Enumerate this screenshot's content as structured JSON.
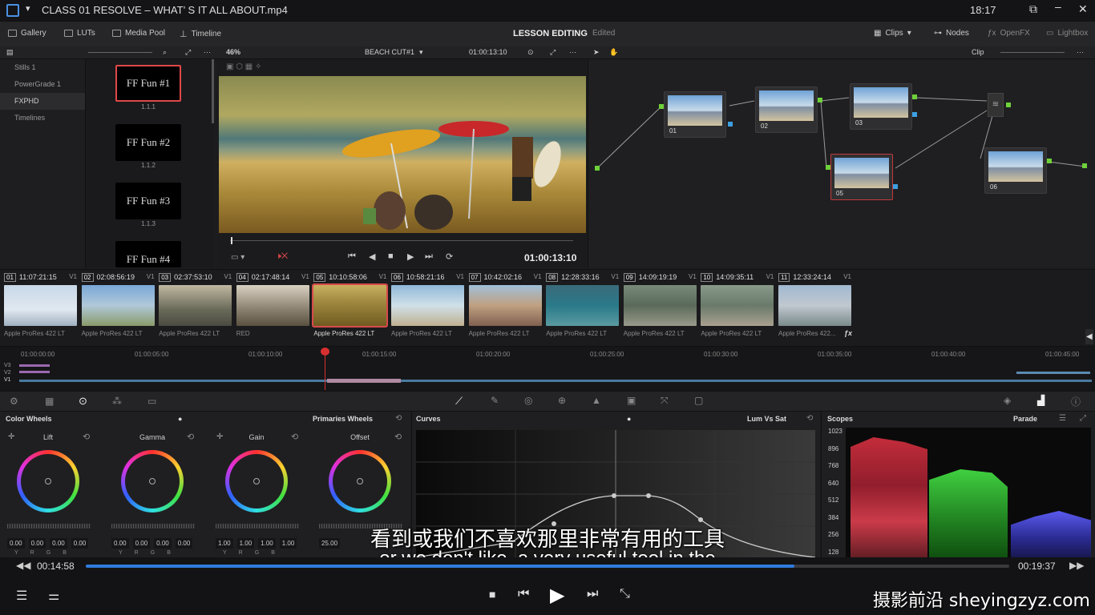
{
  "player": {
    "title": "CLASS 01 RESOLVE – WHAT’ S IT ALL ABOUT.mp4",
    "clock": "18:17",
    "current": "00:14:58",
    "total": "00:19:37",
    "progress": 0.767
  },
  "toolbar": {
    "gallery": "Gallery",
    "luts": "LUTs",
    "media_pool": "Media Pool",
    "timeline": "Timeline",
    "project": "LESSON EDITING",
    "status": "Edited",
    "clips": "Clips",
    "nodes": "Nodes",
    "openfx": "OpenFX",
    "lightbox": "Lightbox"
  },
  "subbar": {
    "zoom": "46%",
    "timeline_name": "BEACH CUT#1",
    "timecode": "01:00:13:10",
    "clip_mode": "Clip"
  },
  "gallery": {
    "items": [
      "Stills 1",
      "PowerGrade 1",
      "FXPHD",
      "Timelines"
    ],
    "selected": 2
  },
  "stills": [
    {
      "name": "FF Fun #1",
      "label": "1.1.1"
    },
    {
      "name": "FF Fun #2",
      "label": "1.1.2"
    },
    {
      "name": "FF Fun #3",
      "label": "1.1.3"
    },
    {
      "name": "FF Fun #4",
      "label": ""
    }
  ],
  "viewer": {
    "timecode": "01:00:13:10"
  },
  "nodes": [
    {
      "label": "01"
    },
    {
      "label": "02"
    },
    {
      "label": "03"
    },
    {
      "label": "05"
    },
    {
      "label": "06"
    }
  ],
  "clips": [
    {
      "num": "01",
      "tc": "11:07:21:15",
      "track": "V1",
      "codec": "Apple ProRes 422 LT",
      "bg": "linear-gradient(#c8d8e8,#e0e8f0 60%,#a0b0c0)"
    },
    {
      "num": "02",
      "tc": "02:08:56:19",
      "track": "V1",
      "codec": "Apple ProRes 422 LT",
      "bg": "linear-gradient(#7aa8d8,#b0c8d8 50%,#8a9a6a)"
    },
    {
      "num": "03",
      "tc": "02:37:53:10",
      "track": "V1",
      "codec": "Apple ProRes 422 LT",
      "bg": "linear-gradient(#c0b8a0,#6a6a5a 60%,#4a4a40)"
    },
    {
      "num": "04",
      "tc": "02:17:48:14",
      "track": "V1",
      "codec": "RED",
      "bg": "linear-gradient(#d8d0c0,#8a8070 60%,#5a5040)"
    },
    {
      "num": "05",
      "tc": "10:10:58:06",
      "track": "V1",
      "codec": "Apple ProRes 422 LT",
      "bg": "linear-gradient(#c8b060,#a08a40 40%,#705a20)"
    },
    {
      "num": "06",
      "tc": "10:58:21:16",
      "track": "V1",
      "codec": "Apple ProRes 422 LT",
      "bg": "linear-gradient(#90b8d8,#d0e0e8 50%,#c0b090)"
    },
    {
      "num": "07",
      "tc": "10:42:02:16",
      "track": "V1",
      "codec": "Apple ProRes 422 LT",
      "bg": "linear-gradient(#a0c0d8,#c0a080 50%,#806050)"
    },
    {
      "num": "08",
      "tc": "12:28:33:16",
      "track": "V1",
      "codec": "Apple ProRes 422 LT",
      "bg": "linear-gradient(#3a6a7a,#2a7a8a 50%,#5a9aa0)"
    },
    {
      "num": "09",
      "tc": "14:09:19:19",
      "track": "V1",
      "codec": "Apple ProRes 422 LT",
      "bg": "linear-gradient(#7a8a7a,#5a6a5a 50%,#9a9a8a)"
    },
    {
      "num": "10",
      "tc": "14:09:35:11",
      "track": "V1",
      "codec": "Apple ProRes 422 LT",
      "bg": "linear-gradient(#8a9a8a,#6a7a6a 50%,#aaa090)"
    },
    {
      "num": "11",
      "tc": "12:33:24:14",
      "track": "V1",
      "codec": "Apple ProRes 422...",
      "bg": "linear-gradient(#a0b8d0,#c0c8d0 50%,#7a8a8a)"
    }
  ],
  "timeline": {
    "ticks": [
      "01:00:00:00",
      "01:00:05:00",
      "01:00:10:00",
      "01:00:15:00",
      "01:00:20:00",
      "01:00:25:00",
      "01:00:30:00",
      "01:00:35:00",
      "01:00:40:00",
      "01:00:45:00"
    ],
    "tracks": [
      "V3",
      "V2",
      "V1"
    ]
  },
  "wheels": {
    "title": "Color Wheels",
    "mode": "Primaries Wheels",
    "items": [
      {
        "name": "Lift",
        "vals": [
          "0.00",
          "0.00",
          "0.00",
          "0.00"
        ]
      },
      {
        "name": "Gamma",
        "vals": [
          "0.00",
          "0.00",
          "0.00",
          "0.00"
        ]
      },
      {
        "name": "Gain",
        "vals": [
          "1.00",
          "1.00",
          "1.00",
          "1.00"
        ]
      },
      {
        "name": "Offset",
        "vals": [
          "25.00"
        ]
      }
    ],
    "letters": [
      "Y",
      "R",
      "G",
      "B"
    ]
  },
  "curves": {
    "title": "Curves",
    "mode": "Lum Vs Sat"
  },
  "scopes": {
    "title": "Scopes",
    "mode": "Parade",
    "scale": [
      "1023",
      "896",
      "768",
      "640",
      "512",
      "384",
      "256",
      "128"
    ]
  },
  "subtitle": {
    "zh": "看到或我们不喜欢那里非常有用的工具",
    "en": "or we don't like, a very useful tool in the"
  },
  "watermark": "摄影前沿 sheyingzyz.com"
}
